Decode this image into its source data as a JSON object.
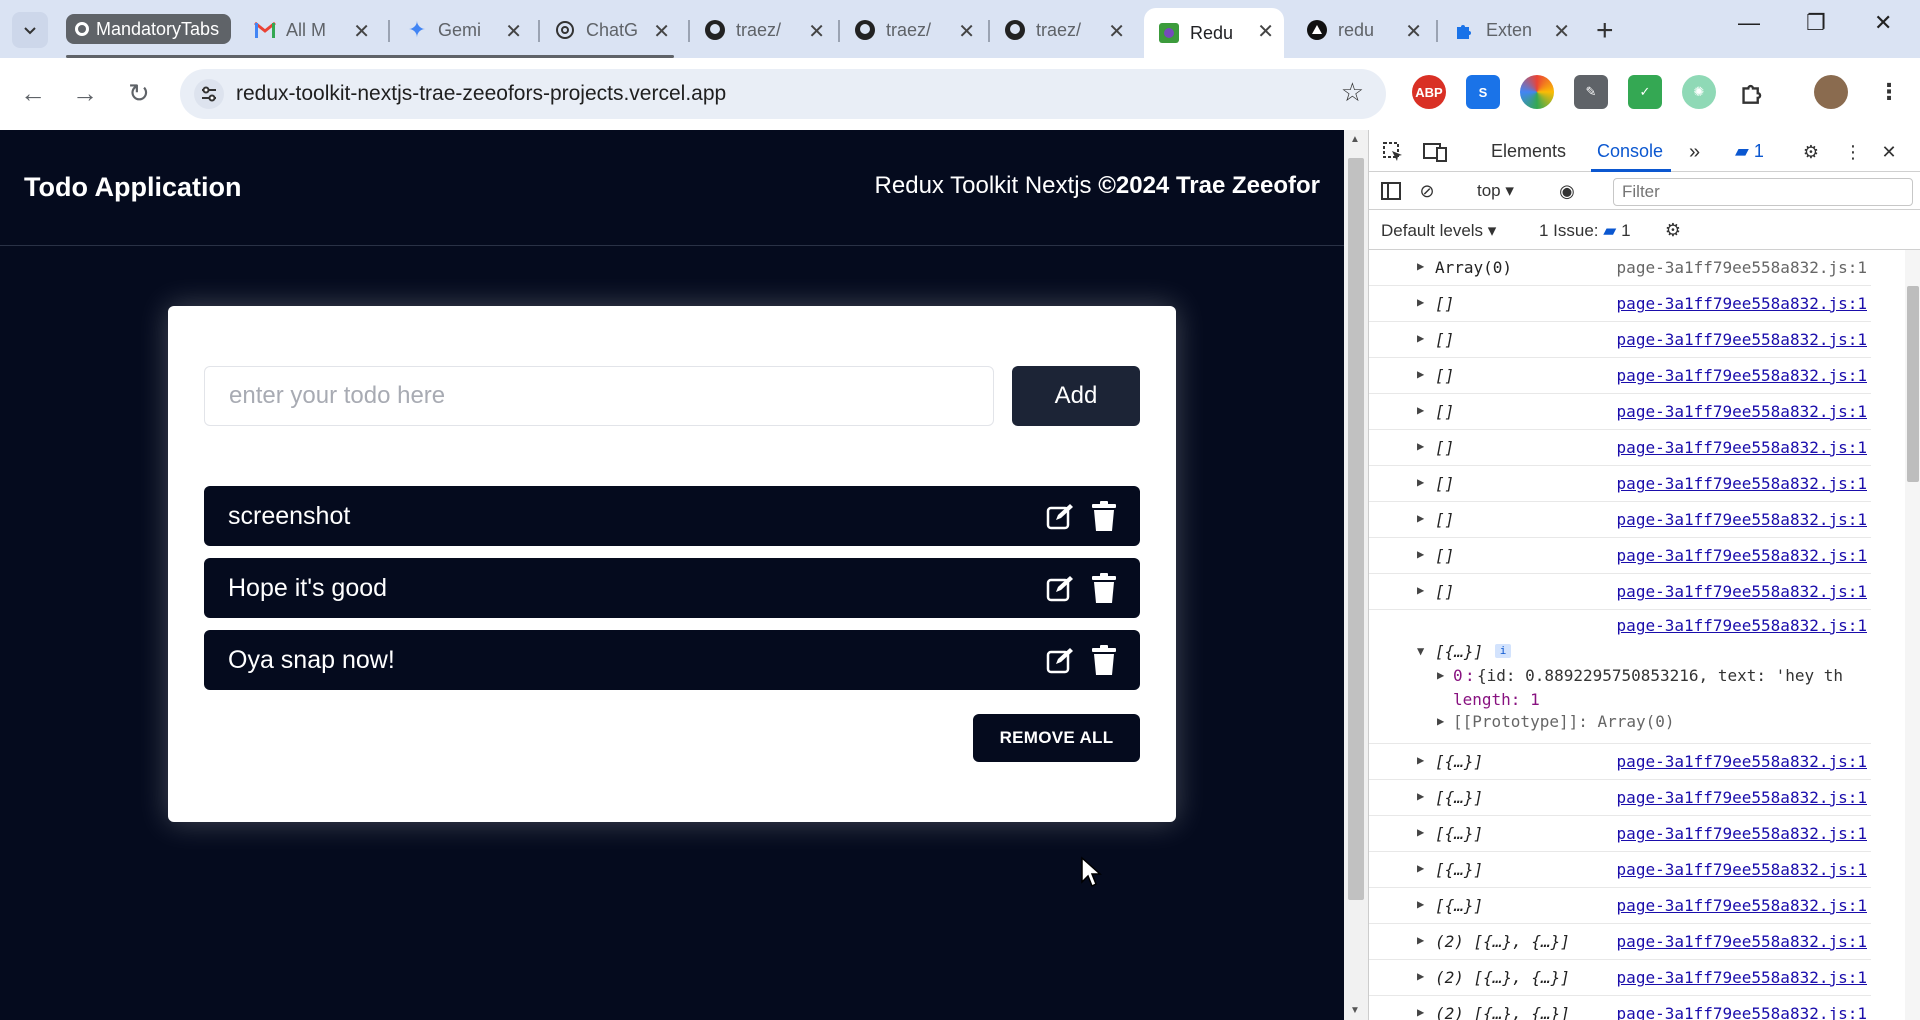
{
  "browser": {
    "tab_group_label": "MandatoryTabs",
    "tabs": [
      {
        "title": "All M",
        "icon": "gmail-icon"
      },
      {
        "title": "Gemi",
        "icon": "gemini-icon"
      },
      {
        "title": "ChatG",
        "icon": "chatgpt-icon"
      },
      {
        "title": "traez/",
        "icon": "github-icon"
      },
      {
        "title": "traez/",
        "icon": "github-icon"
      },
      {
        "title": "traez/",
        "icon": "github-icon"
      },
      {
        "title": "Redu",
        "icon": "redux-icon",
        "active": true
      },
      {
        "title": "redu",
        "icon": "vercel-icon"
      },
      {
        "title": "Exten",
        "icon": "puzzle-icon"
      }
    ],
    "url": "redux-toolkit-nextjs-trae-zeeofors-projects.vercel.app",
    "extensions": [
      "ABP",
      "S",
      "",
      "",
      "",
      ""
    ]
  },
  "app": {
    "title": "Todo Application",
    "credit_prefix": "Redux Toolkit Nextjs ",
    "credit_bold": "©2024 Trae Zeeofor",
    "input_placeholder": "enter your todo here",
    "add_label": "Add",
    "todos": [
      "screenshot",
      "Hope it's good",
      "Oya snap now!"
    ],
    "remove_all_label": "REMOVE ALL"
  },
  "devtools": {
    "tabs": [
      "Elements",
      "Console"
    ],
    "active_tab": "Console",
    "issues_badge": "1",
    "context": "top",
    "filter_placeholder": "Filter",
    "levels": "Default levels",
    "issues_label": "1 Issue:",
    "issues_count": "1",
    "source": "page-3a1ff79ee558a832.js:1",
    "logs": [
      {
        "msg": "Array(0)",
        "plain": true,
        "link": false
      },
      {
        "msg": "[]"
      },
      {
        "msg": "[]"
      },
      {
        "msg": "[]"
      },
      {
        "msg": "[]"
      },
      {
        "msg": "[]"
      },
      {
        "msg": "[]"
      },
      {
        "msg": "[]"
      },
      {
        "msg": "[]"
      },
      {
        "msg": "[]"
      }
    ],
    "expanded": {
      "header": "[{…}]",
      "line0_key": "0",
      "line0_val": "{id: 0.8892295750853216, text: 'hey th",
      "line1": "length: 1",
      "line2": "[[Prototype]]: Array(0)"
    },
    "logs_after": [
      "[{…}]",
      "[{…}]",
      "[{…}]",
      "[{…}]",
      "[{…}]",
      "(2) [{…}, {…}]",
      "(2) [{…}, {…}]",
      "(2) [{…}, {…}]"
    ]
  }
}
